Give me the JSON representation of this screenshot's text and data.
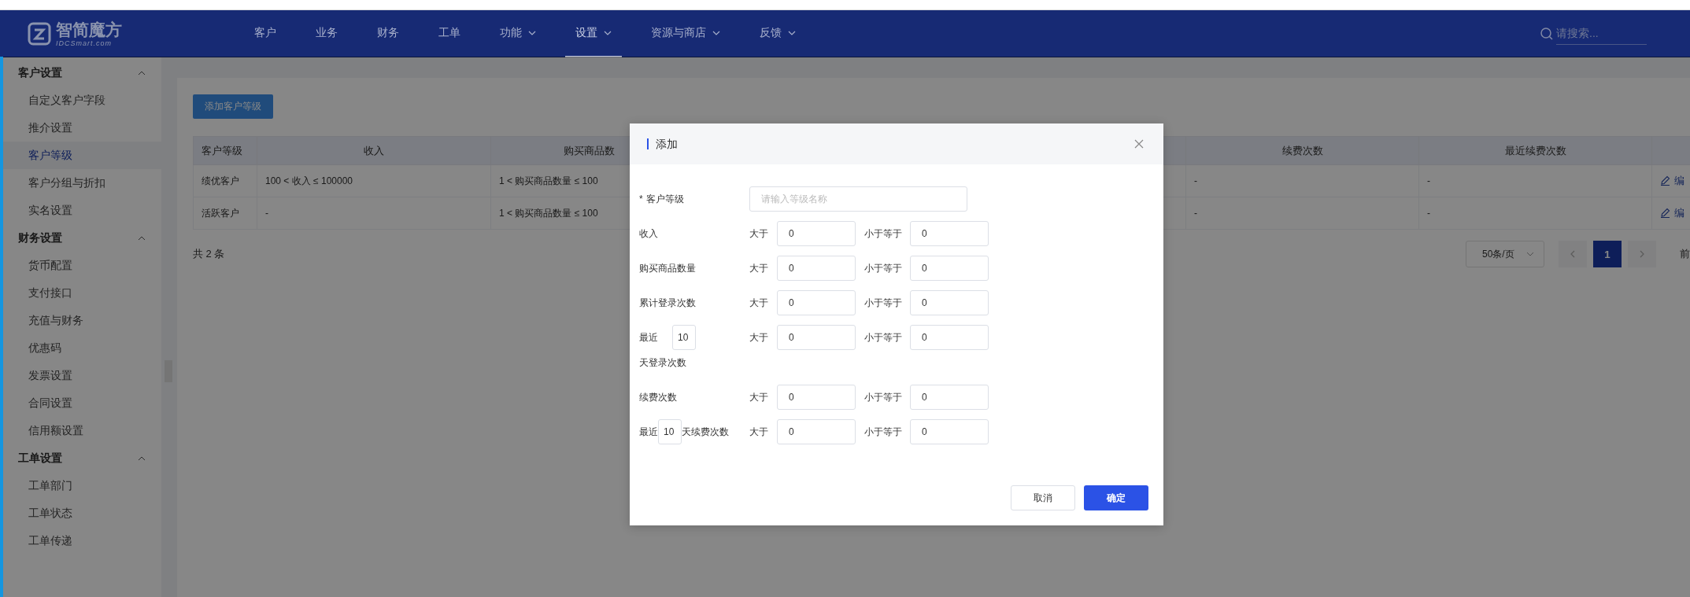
{
  "nav": {
    "logo": {
      "title": "智简魔方",
      "subtitle": "IDCSmart.com"
    },
    "items": [
      {
        "label": "客户",
        "has_menu": false,
        "selected": false
      },
      {
        "label": "业务",
        "has_menu": false,
        "selected": false
      },
      {
        "label": "财务",
        "has_menu": false,
        "selected": false
      },
      {
        "label": "工单",
        "has_menu": false,
        "selected": false
      },
      {
        "label": "功能",
        "has_menu": true,
        "selected": false
      },
      {
        "label": "设置",
        "has_menu": true,
        "selected": true
      },
      {
        "label": "资源与商店",
        "has_menu": true,
        "selected": false
      },
      {
        "label": "反馈",
        "has_menu": true,
        "selected": false
      }
    ],
    "search": {
      "placeholder": "请搜索..."
    }
  },
  "sidebar": {
    "groups": [
      {
        "title": "客户设置",
        "expanded": true,
        "items": [
          {
            "label": "自定义客户字段",
            "selected": false
          },
          {
            "label": "推介设置",
            "selected": false
          },
          {
            "label": "客户等级",
            "selected": true
          },
          {
            "label": "客户分组与折扣",
            "selected": false
          },
          {
            "label": "实名设置",
            "selected": false
          }
        ]
      },
      {
        "title": "财务设置",
        "expanded": true,
        "items": [
          {
            "label": "货币配置",
            "selected": false
          },
          {
            "label": "支付接口",
            "selected": false
          },
          {
            "label": "充值与财务",
            "selected": false
          },
          {
            "label": "优惠码",
            "selected": false
          },
          {
            "label": "发票设置",
            "selected": false
          },
          {
            "label": "合同设置",
            "selected": false
          },
          {
            "label": "信用额设置",
            "selected": false
          }
        ]
      },
      {
        "title": "工单设置",
        "expanded": true,
        "items": [
          {
            "label": "工单部门",
            "selected": false
          },
          {
            "label": "工单状态",
            "selected": false
          },
          {
            "label": "工单传递",
            "selected": false
          }
        ]
      }
    ]
  },
  "add_button": "添加客户等级",
  "table": {
    "columns": [
      "客户等级",
      "收入",
      "购买商品数",
      "续费次数",
      "最近续费次数"
    ],
    "rows": [
      {
        "cells": [
          "绩优客户",
          "100 < 收入 ≤ 100000",
          "1 < 购买商品数量 ≤ 100",
          "-",
          "-"
        ],
        "action": "编"
      },
      {
        "cells": [
          "活跃客户",
          "-",
          "1 < 购买商品数量 ≤ 100",
          "-",
          "-"
        ],
        "action": "编"
      }
    ]
  },
  "pagination": {
    "total": "共 2 条",
    "page_size": "50条/页",
    "pages": [
      {
        "label": "1",
        "selected": true
      }
    ],
    "jump_label": "前"
  },
  "dialog": {
    "title": "添加",
    "rows": [
      {
        "kind": "name",
        "required_mark": "*",
        "label": "客户等级",
        "placeholder": "请输入等级名称"
      },
      {
        "kind": "range",
        "label": "收入",
        "gt_label": "大于",
        "gt_value": "0",
        "le_label": "小于等于",
        "le_value": "0"
      },
      {
        "kind": "range",
        "label": "购买商品数量",
        "gt_label": "大于",
        "gt_value": "0",
        "le_label": "小于等于",
        "le_value": "0"
      },
      {
        "kind": "range",
        "label": "累计登录次数",
        "gt_label": "大于",
        "gt_value": "0",
        "le_label": "小于等于",
        "le_value": "0"
      },
      {
        "kind": "recent-login",
        "prefix": "最近",
        "days": "10",
        "suffix": "天登录次数",
        "gt_label": "大于",
        "gt_value": "0",
        "le_label": "小于等于",
        "le_value": "0"
      },
      {
        "kind": "range",
        "label": "续费次数",
        "gt_label": "大于",
        "gt_value": "0",
        "le_label": "小于等于",
        "le_value": "0"
      },
      {
        "kind": "recent-renewal",
        "prefix": "最近",
        "days": "10",
        "suffix": "天续费次数",
        "gt_label": "大于",
        "gt_value": "0",
        "le_label": "小于等于",
        "le_value": "0"
      }
    ],
    "buttons": {
      "cancel": "取消",
      "confirm": "确定"
    }
  }
}
